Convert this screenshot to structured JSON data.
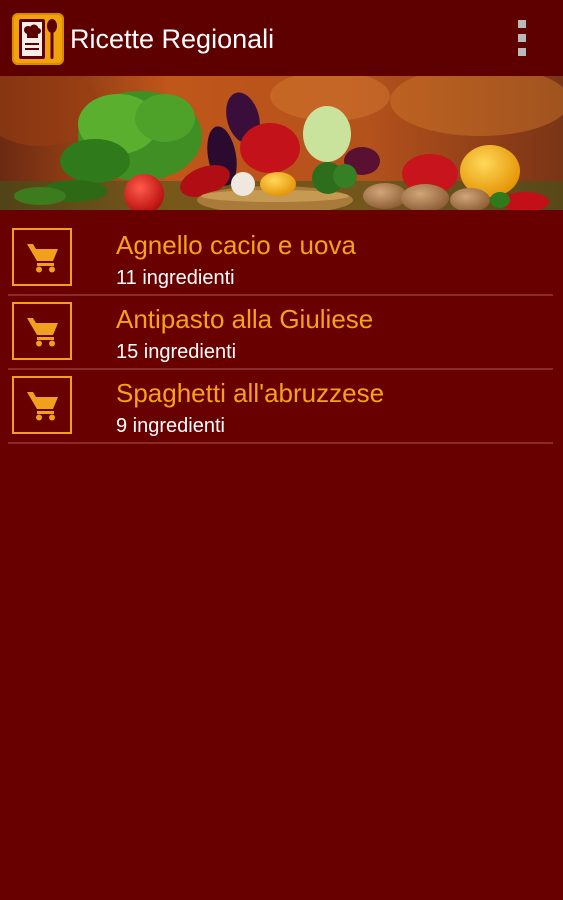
{
  "appbar": {
    "title": "Ricette Regionali",
    "app_icon": "recipe-book-icon",
    "menu_icon": "overflow-menu-icon"
  },
  "banner": {
    "image": "vegetables-basket-banner"
  },
  "recipes": [
    {
      "name": "Agnello cacio e uova",
      "count": "11 ingredienti",
      "icon": "shopping-cart-icon"
    },
    {
      "name": "Antipasto alla Giuliese",
      "count": "15 ingredienti",
      "icon": "shopping-cart-icon"
    },
    {
      "name": "Spaghetti all'abruzzese",
      "count": "9 ingredienti",
      "icon": "shopping-cart-icon"
    }
  ],
  "colors": {
    "background": "#680000",
    "appbar": "#5e0000",
    "accent": "#f5a21a",
    "text": "#ffffff",
    "divider": "#8a2a2a"
  }
}
